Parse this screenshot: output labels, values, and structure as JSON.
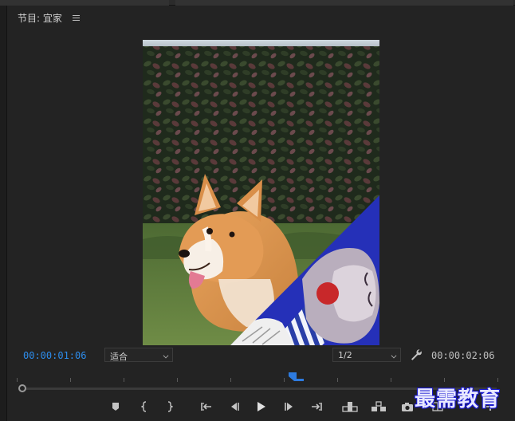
{
  "panel": {
    "title": "节目: 宜家"
  },
  "playback": {
    "current_timecode": "00:00:01:06",
    "duration_timecode": "00:00:02:06",
    "zoom_value": "适合",
    "quality_value": "1/2"
  },
  "watermark": {
    "text": "最需教育"
  },
  "colors": {
    "accent": "#2d8ceb",
    "panel_bg": "#232323",
    "watermark_outline": "#1a1ad0"
  },
  "icons": {
    "menu": "hamburger-menu-icon",
    "settings": "wrench-icon",
    "playhead": "playhead-marker-icon",
    "controls": [
      "add-marker-icon",
      "mark-in-icon",
      "mark-out-icon",
      "go-to-in-icon",
      "step-back-icon",
      "play-icon",
      "step-forward-icon",
      "go-to-out-icon",
      "lift-icon",
      "extract-icon",
      "export-frame-icon",
      "compare-view-icon",
      "add-button-icon"
    ]
  }
}
